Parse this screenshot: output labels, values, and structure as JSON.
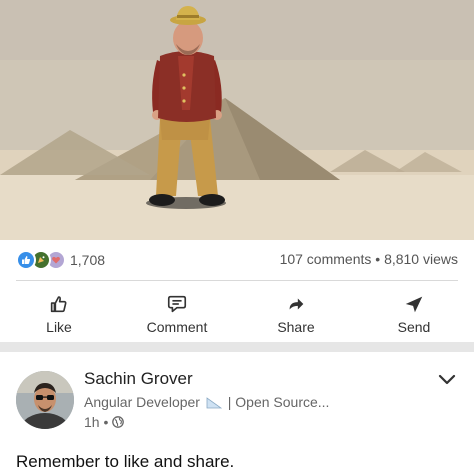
{
  "video": {
    "scene": "animated-character-pyramids"
  },
  "social": {
    "reaction_icons": [
      "like-icon",
      "celebrate-icon",
      "love-icon"
    ],
    "reaction_count": "1,708",
    "comments_views": "107 comments • 8,810 views"
  },
  "actions": [
    {
      "label": "Like",
      "icon": "thumbs-up-icon"
    },
    {
      "label": "Comment",
      "icon": "comment-icon"
    },
    {
      "label": "Share",
      "icon": "share-arrow-icon"
    },
    {
      "label": "Send",
      "icon": "send-icon"
    }
  ],
  "post": {
    "author": "Sachin Grover",
    "headline_a": "Angular Developer",
    "headline_b": "| Open Source...",
    "time": "1h •",
    "text": "Remember to like and share."
  },
  "colors": {
    "like_blue": "#378fe9",
    "celebrate_green": "#44712e",
    "text_dark": "#222222",
    "text_muted": "#666666"
  }
}
